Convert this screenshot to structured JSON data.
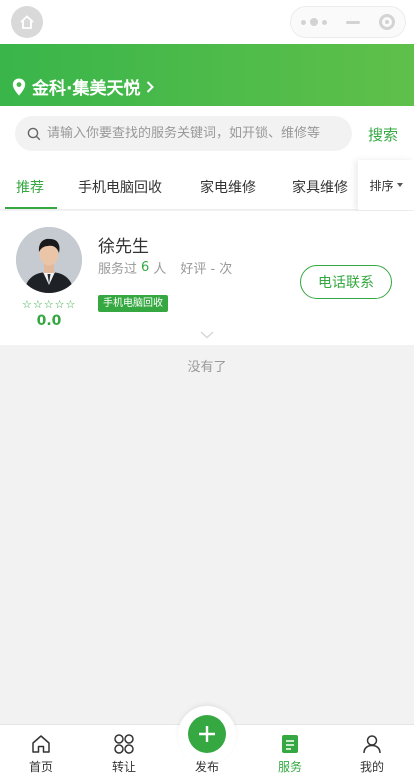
{
  "location": {
    "label": "金科·集美天悦"
  },
  "search": {
    "placeholder": "请输入你要查找的服务关键词，如开锁、维修等",
    "button_label": "搜索"
  },
  "tabs": {
    "items": [
      {
        "label": "推荐",
        "active": true
      },
      {
        "label": "手机电脑回收",
        "active": false
      },
      {
        "label": "家电维修",
        "active": false
      },
      {
        "label": "家具维修",
        "active": false
      }
    ],
    "sort_label": "排序"
  },
  "provider": {
    "name": "徐先生",
    "served_prefix": "服务过",
    "served_count": "6",
    "served_suffix": "人",
    "praise_text": "好评 - 次",
    "rating": "0.0",
    "stars": [
      "☆",
      "☆",
      "☆",
      "☆",
      "☆"
    ],
    "tag": "手机电脑回收",
    "call_label": "电话联系"
  },
  "list_end_text": "没有了",
  "bottom_nav": {
    "items": [
      {
        "label": "首页",
        "icon": "home-icon",
        "active": false
      },
      {
        "label": "转让",
        "icon": "transfer-icon",
        "active": false
      },
      {
        "label": "发布",
        "icon": "plus-icon",
        "active": false
      },
      {
        "label": "服务",
        "icon": "service-icon",
        "active": true
      },
      {
        "label": "我的",
        "icon": "user-icon",
        "active": false
      }
    ]
  },
  "colors": {
    "brand": "#35a842",
    "header_gradient": [
      "#39b54a",
      "#5fc04a"
    ]
  }
}
